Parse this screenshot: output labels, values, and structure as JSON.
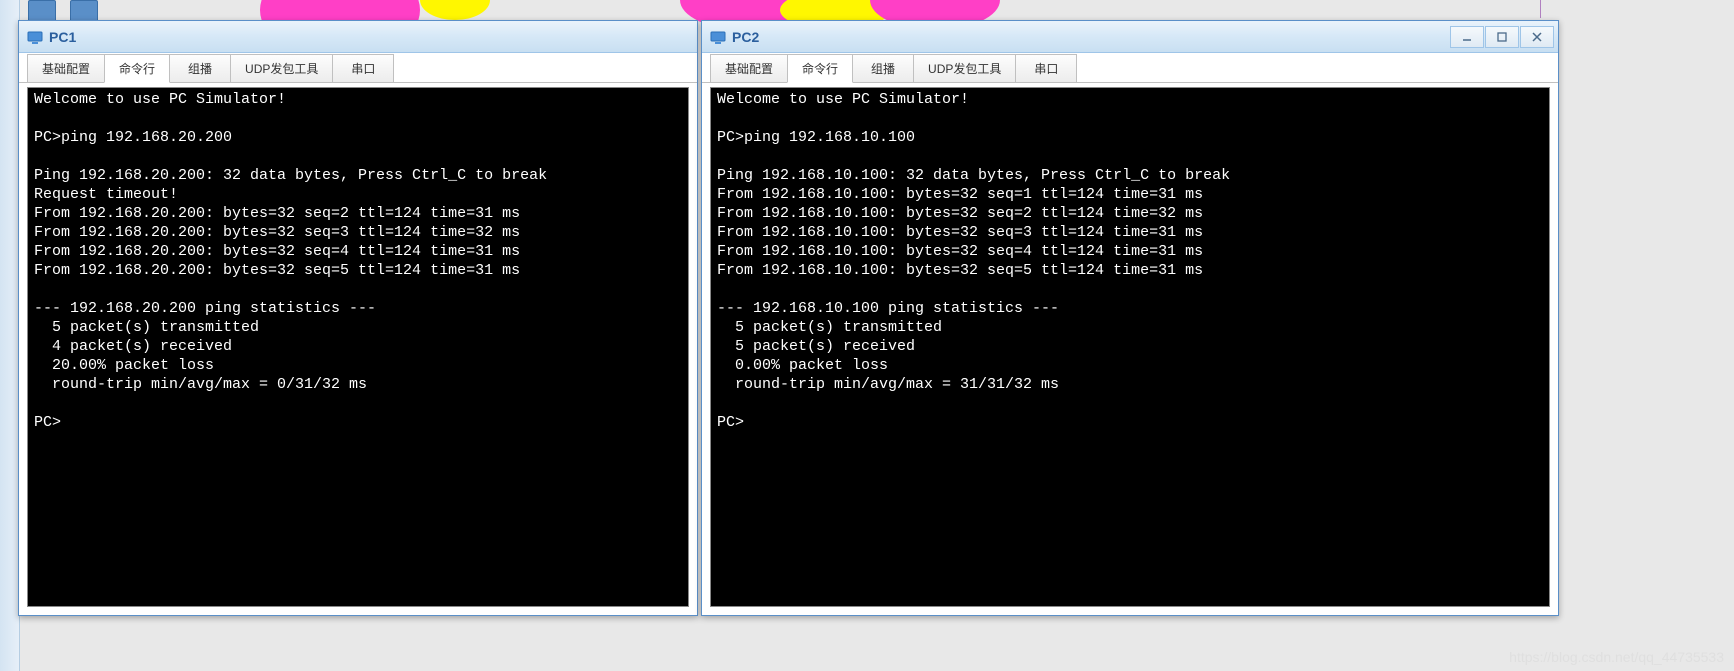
{
  "watermark": "https://blog.csdn.net/qq_44735533",
  "tabs": {
    "basic": "基础配置",
    "cli": "命令行",
    "multicast": "组播",
    "udp": "UDP发包工具",
    "serial": "串口"
  },
  "windows": [
    {
      "title": "PC1",
      "hasControls": false,
      "terminal": "Welcome to use PC Simulator!\n\nPC>ping 192.168.20.200\n\nPing 192.168.20.200: 32 data bytes, Press Ctrl_C to break\nRequest timeout!\nFrom 192.168.20.200: bytes=32 seq=2 ttl=124 time=31 ms\nFrom 192.168.20.200: bytes=32 seq=3 ttl=124 time=32 ms\nFrom 192.168.20.200: bytes=32 seq=4 ttl=124 time=31 ms\nFrom 192.168.20.200: bytes=32 seq=5 ttl=124 time=31 ms\n\n--- 192.168.20.200 ping statistics ---\n  5 packet(s) transmitted\n  4 packet(s) received\n  20.00% packet loss\n  round-trip min/avg/max = 0/31/32 ms\n\nPC>"
    },
    {
      "title": "PC2",
      "hasControls": true,
      "terminal": "Welcome to use PC Simulator!\n\nPC>ping 192.168.10.100\n\nPing 192.168.10.100: 32 data bytes, Press Ctrl_C to break\nFrom 192.168.10.100: bytes=32 seq=1 ttl=124 time=31 ms\nFrom 192.168.10.100: bytes=32 seq=2 ttl=124 time=32 ms\nFrom 192.168.10.100: bytes=32 seq=3 ttl=124 time=31 ms\nFrom 192.168.10.100: bytes=32 seq=4 ttl=124 time=31 ms\nFrom 192.168.10.100: bytes=32 seq=5 ttl=124 time=31 ms\n\n--- 192.168.10.100 ping statistics ---\n  5 packet(s) transmitted\n  5 packet(s) received\n  0.00% packet loss\n  round-trip min/avg/max = 31/31/32 ms\n\nPC>"
    }
  ]
}
